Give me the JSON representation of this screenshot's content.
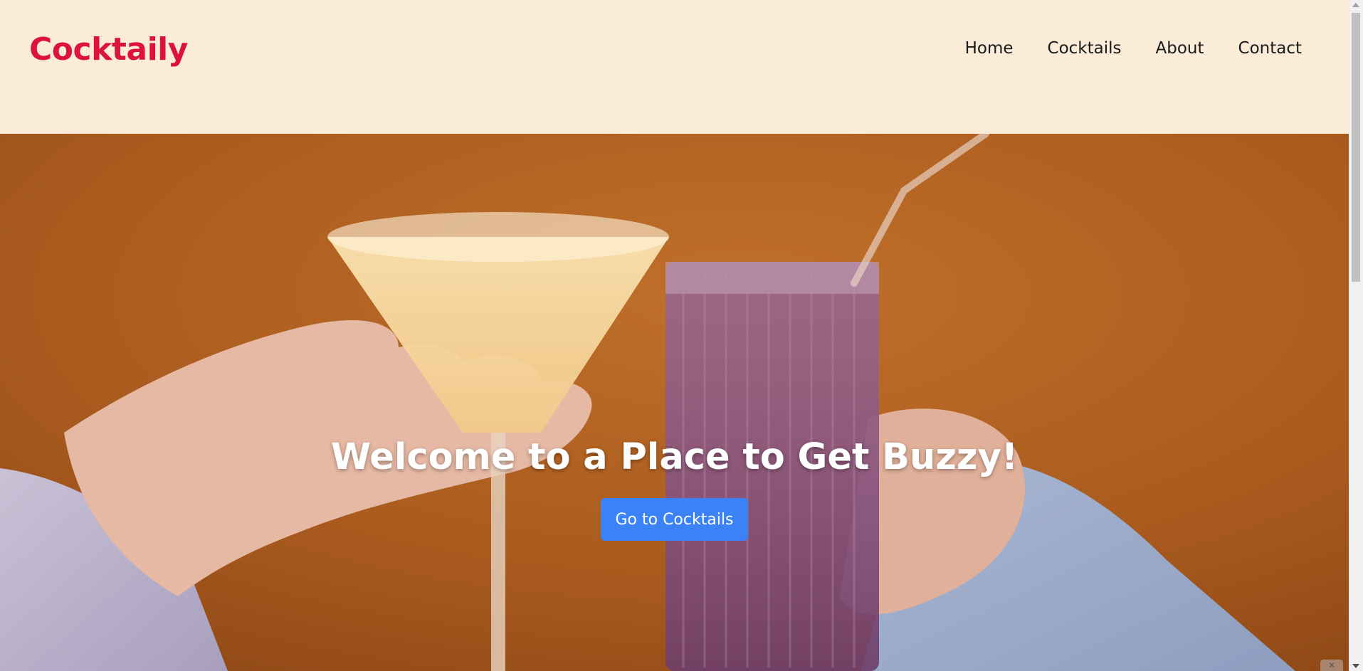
{
  "header": {
    "brand": "Cocktaily",
    "nav": [
      {
        "label": "Home"
      },
      {
        "label": "Cocktails"
      },
      {
        "label": "About"
      },
      {
        "label": "Contact"
      }
    ]
  },
  "hero": {
    "title": "Welcome to a Place to Get Buzzy!",
    "button_label": "Go to Cocktails",
    "image_description": "cocktail-glasses-toast"
  },
  "colors": {
    "header_bg": "#fbecd8",
    "brand": "#dc143c",
    "button_bg": "#3b82f6",
    "hero_bg": "#a85a1e"
  }
}
